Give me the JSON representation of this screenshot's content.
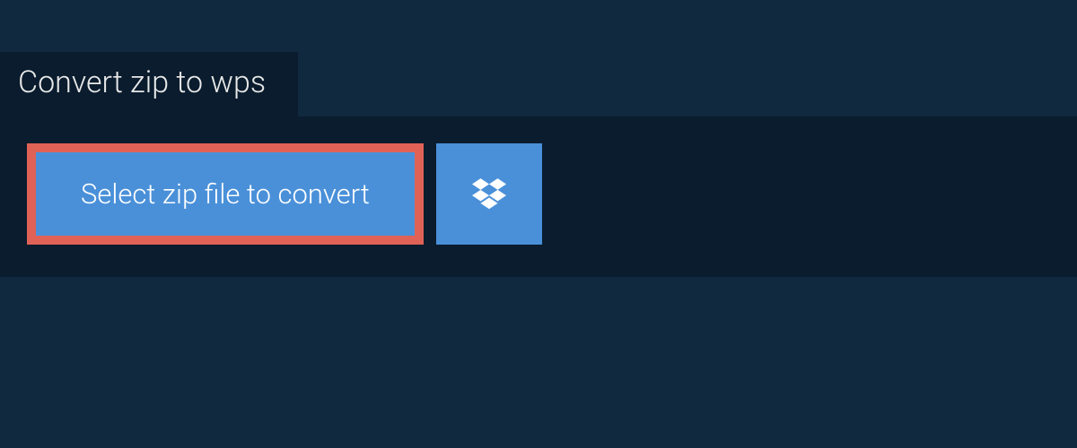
{
  "tab": {
    "title": "Convert zip to wps"
  },
  "actions": {
    "select_file_label": "Select zip file to convert"
  },
  "colors": {
    "page_bg": "#10293f",
    "panel_bg": "#0a1c2e",
    "button_bg": "#4a90d9",
    "highlight_border": "#e06257",
    "text_light": "#ffffff"
  }
}
